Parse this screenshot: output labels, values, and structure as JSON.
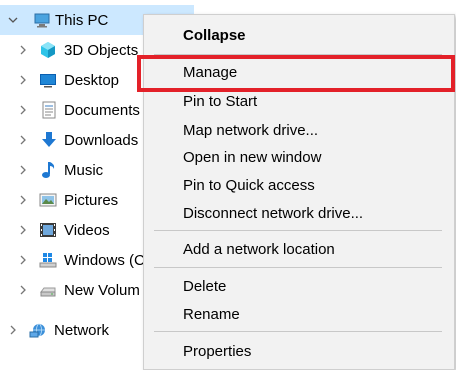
{
  "tree": {
    "root": {
      "label": "This PC",
      "icon": "pc-icon"
    },
    "items": [
      {
        "label": "3D Objects",
        "icon": "3d-objects-icon"
      },
      {
        "label": "Desktop",
        "icon": "desktop-icon"
      },
      {
        "label": "Documents",
        "icon": "documents-icon"
      },
      {
        "label": "Downloads",
        "icon": "downloads-icon"
      },
      {
        "label": "Music",
        "icon": "music-icon"
      },
      {
        "label": "Pictures",
        "icon": "pictures-icon"
      },
      {
        "label": "Videos",
        "icon": "videos-icon"
      },
      {
        "label": "Windows (C",
        "icon": "windows-drive-icon"
      },
      {
        "label": "New Volum",
        "icon": "drive-icon"
      }
    ],
    "network": {
      "label": "Network",
      "icon": "network-icon"
    }
  },
  "menu": {
    "items": [
      {
        "label": "Collapse"
      },
      {
        "label": "Manage"
      },
      {
        "label": "Pin to Start"
      },
      {
        "label": "Map network drive..."
      },
      {
        "label": "Open in new window"
      },
      {
        "label": "Pin to Quick access"
      },
      {
        "label": "Disconnect network drive..."
      },
      {
        "label": "Add a network location"
      },
      {
        "label": "Delete"
      },
      {
        "label": "Rename"
      },
      {
        "label": "Properties"
      }
    ]
  },
  "colors": {
    "selection": "#cce8ff",
    "highlight_border": "#e32129",
    "menu_bg": "#f2f2f2"
  }
}
